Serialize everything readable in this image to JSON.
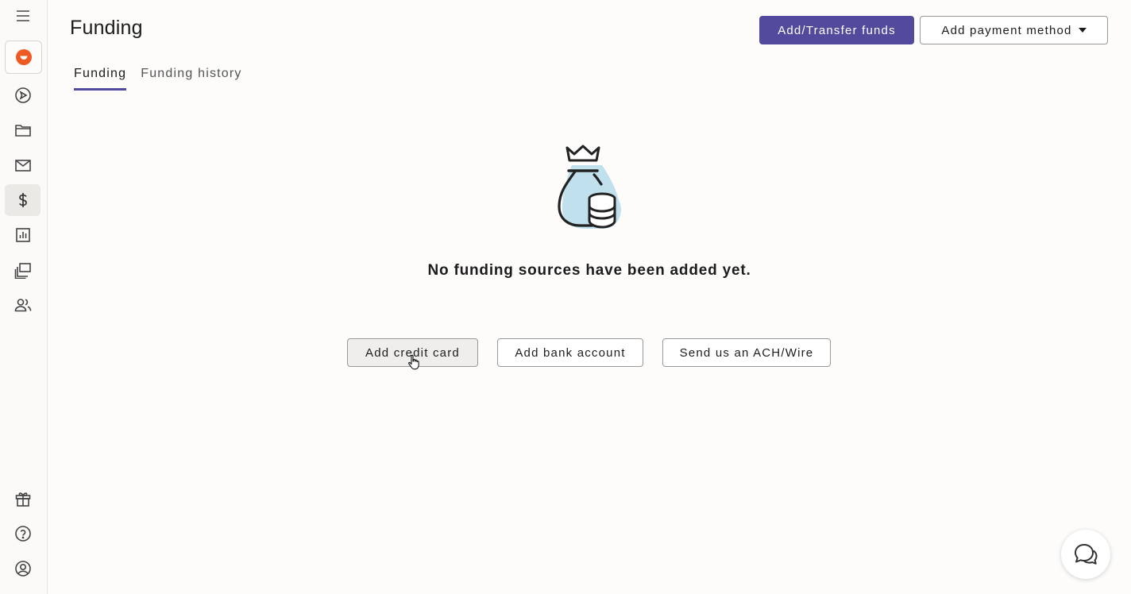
{
  "page": {
    "title": "Funding"
  },
  "header": {
    "primary_button": "Add/Transfer funds",
    "payment_method_button": "Add payment method"
  },
  "tabs": [
    {
      "label": "Funding",
      "active": true
    },
    {
      "label": "Funding history",
      "active": false
    }
  ],
  "empty_state": {
    "icon": "money-bag-icon",
    "message": "No funding sources have been added yet."
  },
  "actions": {
    "credit_card": "Add credit card",
    "bank_account": "Add bank account",
    "ach_wire": "Send us an ACH/Wire"
  },
  "sidebar": {
    "items": [
      {
        "icon": "menu-icon"
      },
      {
        "icon": "brand-logo-icon"
      },
      {
        "icon": "send-icon"
      },
      {
        "icon": "folder-icon"
      },
      {
        "icon": "mail-icon"
      },
      {
        "icon": "dollar-icon",
        "active": true
      },
      {
        "icon": "bar-chart-icon"
      },
      {
        "icon": "layers-icon"
      },
      {
        "icon": "team-icon"
      },
      {
        "icon": "gift-icon"
      },
      {
        "icon": "help-icon"
      },
      {
        "icon": "account-icon"
      }
    ]
  },
  "colors": {
    "accent": "#514a9d",
    "brand": "#ee5a24",
    "illustration": "#bfe0ec",
    "text": "#1c1c1c"
  }
}
